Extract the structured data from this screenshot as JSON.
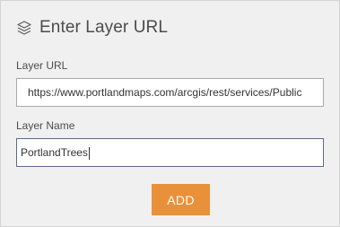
{
  "dialog": {
    "title": "Enter Layer URL",
    "icon": "layers-icon"
  },
  "fields": {
    "url": {
      "label": "Layer URL",
      "value": "https://www.portlandmaps.com/arcgis/rest/services/Public"
    },
    "name": {
      "label": "Layer Name",
      "value": "PortlandTrees"
    }
  },
  "actions": {
    "add_label": "ADD"
  },
  "colors": {
    "panel_bg": "#f0f0f0",
    "accent": "#e8913a",
    "text": "#4c4c4c",
    "focused_border": "#5a6a85"
  }
}
